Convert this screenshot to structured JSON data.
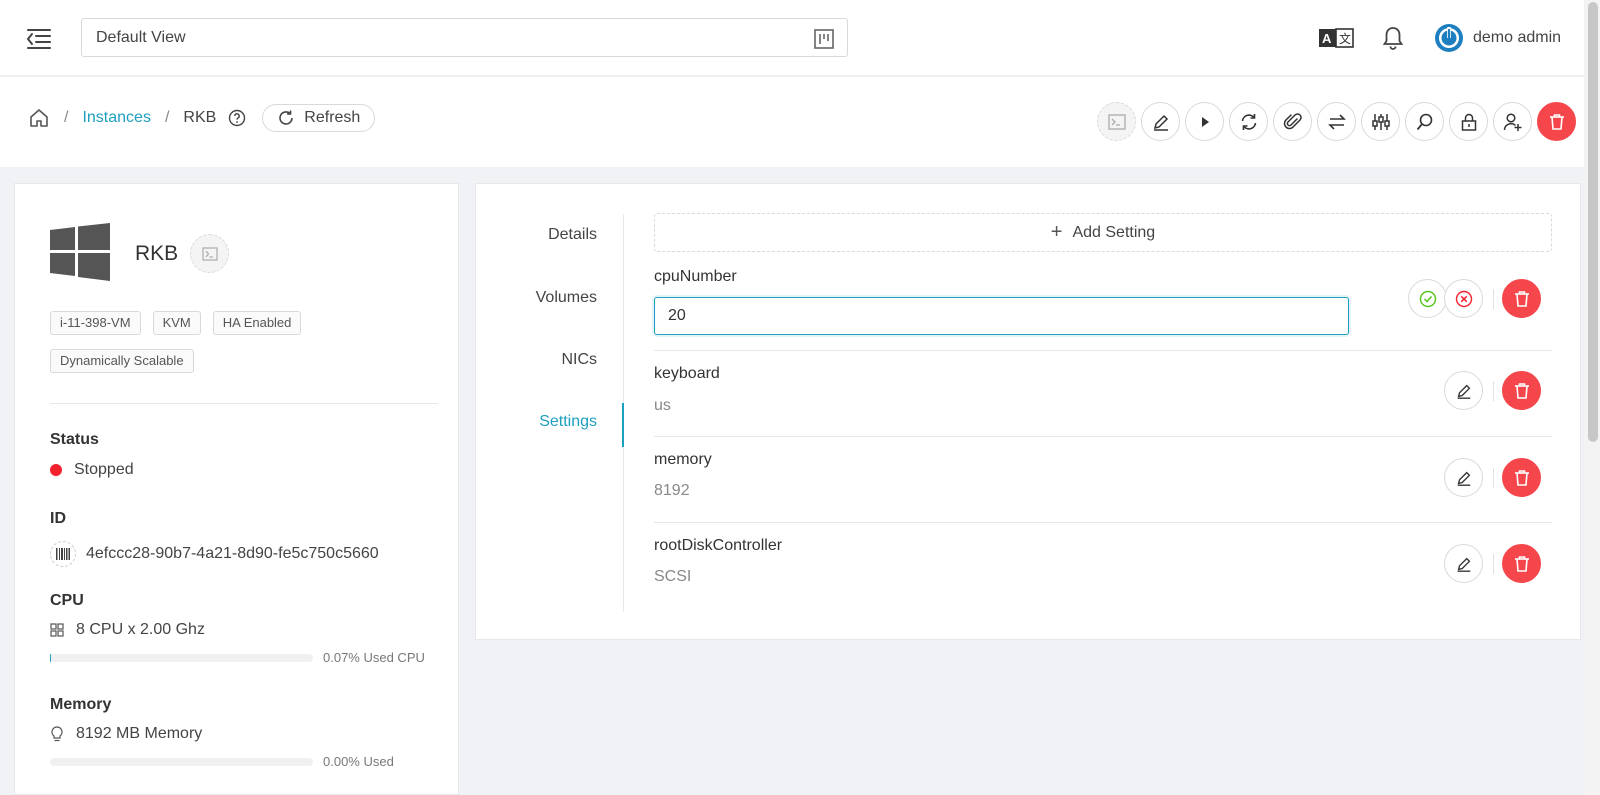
{
  "header": {
    "view_select_value": "Default View",
    "user_name": "demo admin"
  },
  "breadcrumb": {
    "instances_label": "Instances",
    "current": "RKB",
    "refresh_label": "Refresh"
  },
  "actions": [
    "console-icon",
    "edit-icon",
    "start-icon",
    "reinstall-icon",
    "attach-iso-icon",
    "migrate-icon",
    "scale-icon",
    "diagnostics-icon",
    "reset-password-icon",
    "assign-user-icon",
    "delete-icon"
  ],
  "vm": {
    "name": "RKB",
    "tags": [
      "i-11-398-VM",
      "KVM",
      "HA Enabled",
      "Dynamically Scalable"
    ],
    "status_label": "Status",
    "status": "Stopped",
    "status_color": "#f5222d",
    "id_label": "ID",
    "id": "4efccc28-90b7-4a21-8d90-fe5c750c5660",
    "cpu_label": "CPU",
    "cpu": "8 CPU x 2.00 Ghz",
    "cpu_used_text": "0.07% Used CPU",
    "cpu_used_fraction": 0.0007,
    "memory_label": "Memory",
    "memory": "8192 MB Memory",
    "memory_used_text": "0.00% Used",
    "memory_used_fraction": 0
  },
  "tabs": {
    "details": "Details",
    "volumes": "Volumes",
    "nics": "NICs",
    "settings": "Settings",
    "active": "Settings"
  },
  "settings": {
    "add_label": "Add Setting",
    "editing_key": "cpuNumber",
    "editing_value": "20",
    "rows": [
      {
        "key": "keyboard",
        "value": "us"
      },
      {
        "key": "memory",
        "value": "8192"
      },
      {
        "key": "rootDiskController",
        "value": "SCSI"
      }
    ]
  },
  "colors": {
    "accent": "#1d9fc0",
    "danger": "#f5474b"
  }
}
